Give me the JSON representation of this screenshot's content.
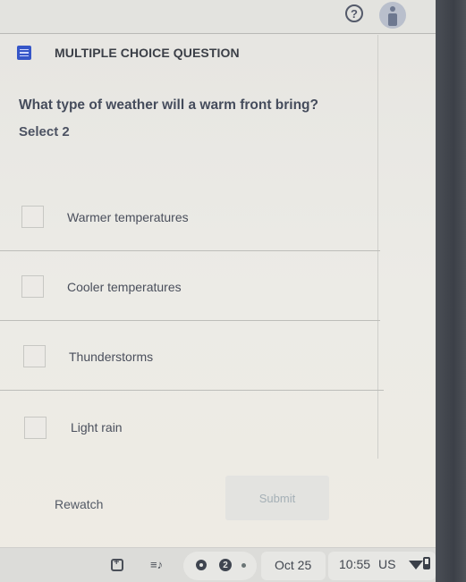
{
  "topbar": {
    "help_icon": "question-circle-icon",
    "help_glyph": "?",
    "avatar_icon": "user-avatar-icon"
  },
  "question": {
    "type_icon": "list-icon",
    "type_label": "MULTIPLE CHOICE QUESTION",
    "prompt": "What type of weather will a warm front bring?",
    "instruction": "Select 2",
    "options": [
      {
        "label": "Warmer temperatures",
        "checked": false
      },
      {
        "label": "Cooler temperatures",
        "checked": false
      },
      {
        "label": "Thunderstorms",
        "checked": false
      },
      {
        "label": "Light rain",
        "checked": false
      }
    ]
  },
  "actions": {
    "rewatch_label": "Rewatch",
    "submit_label": "Submit",
    "submit_enabled": false
  },
  "shelf": {
    "icons": [
      "screen-capture-icon",
      "media-controls-icon",
      "circle-icon",
      "notification-badge-icon",
      "dot-icon"
    ],
    "media_glyph": "≡♪",
    "notification_count": "2",
    "date": "Oct 25",
    "time": "10:55",
    "region": "US",
    "wifi_icon": "wifi-icon",
    "battery_icon": "battery-icon"
  },
  "colors": {
    "accent": "#3656c8",
    "text": "#454c5c",
    "background": "#e9e8e4"
  }
}
